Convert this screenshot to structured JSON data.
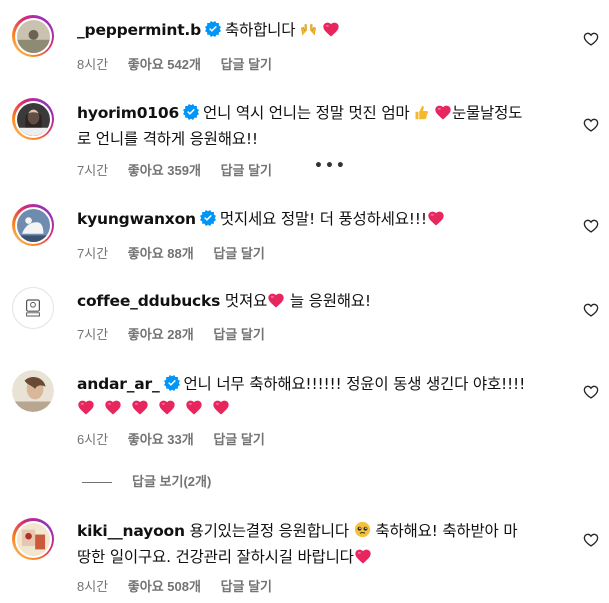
{
  "comments": [
    {
      "username": "_peppermint.b",
      "verified": true,
      "text_line1": "축하합니다",
      "text_line2": "",
      "time": "8시간",
      "likes": "좋아요 542개",
      "reply": "답글 달기"
    },
    {
      "username": "hyorim0106",
      "verified": true,
      "text_line1": "언니 역시 언니는 정말 멋진 엄마",
      "text_line1b": "눈물날정도",
      "text_line2": "로 언니를 격하게 응원해요!!",
      "time": "7시간",
      "likes": "좋아요 359개",
      "reply": "답글 달기",
      "more": "•••"
    },
    {
      "username": "kyungwanxon",
      "verified": true,
      "text_line1": "멋지세요 정말! 더 풍성하세요!!!",
      "time": "7시간",
      "likes": "좋아요 88개",
      "reply": "답글 달기"
    },
    {
      "username": "coffee_ddubucks",
      "verified": false,
      "text_line1": "멋져요",
      "text_line1b": "늘 응원해요!",
      "time": "7시간",
      "likes": "좋아요 28개",
      "reply": "답글 달기"
    },
    {
      "username": "andar_ar_",
      "verified": true,
      "text_line1": "언니 너무 축하해요!!!!!! 정윤이 동생 생긴다 야호!!!!",
      "time": "6시간",
      "likes": "좋아요 33개",
      "reply": "답글 달기"
    },
    {
      "username": "kiki__nayoon",
      "verified": false,
      "text_line1": "용기있는결정 응원합니다",
      "text_line1b": "축하해요! 축하받아 마",
      "text_line2": "땅한 일이구요. 건강관리 잘하시길 바랍니다",
      "time": "8시간",
      "likes": "좋아요 508개",
      "reply": "답글 달기"
    }
  ],
  "view_replies": "답글 보기(2개)",
  "icons": {
    "like": "heart-outline-icon",
    "verified": "verified-badge-icon",
    "heart": "red-heart-emoji"
  },
  "colors": {
    "verified": "#0095f6",
    "heart": "#e8265e",
    "meta": "#737373"
  }
}
